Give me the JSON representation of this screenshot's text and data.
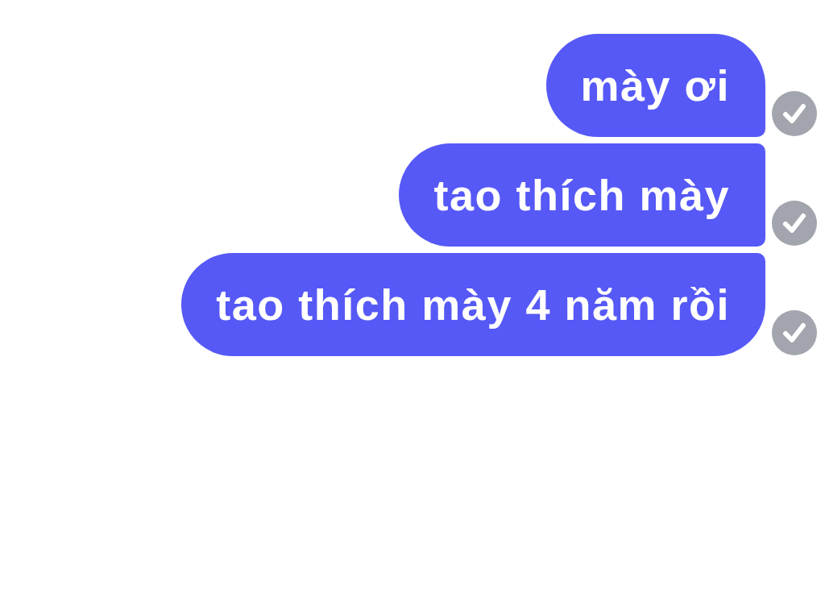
{
  "messages": [
    {
      "text": "mày ơi",
      "delivered": true
    },
    {
      "text": "tao thích mày",
      "delivered": true
    },
    {
      "text": "tao thích mày 4 năm rồi",
      "delivered": true
    }
  ]
}
